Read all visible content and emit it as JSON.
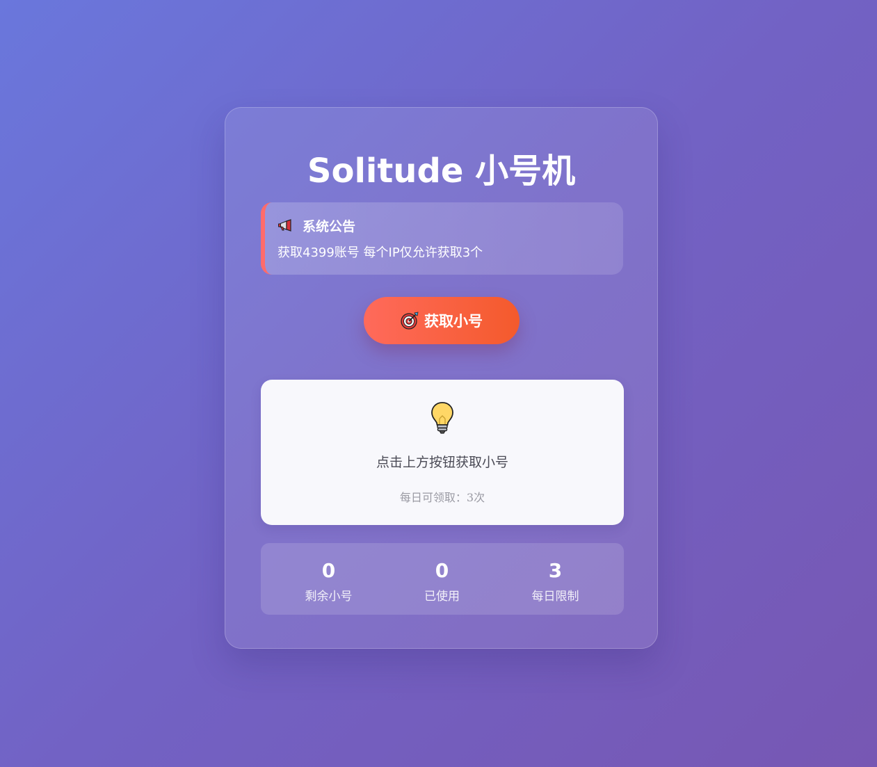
{
  "app": {
    "title": "Solitude 小号机"
  },
  "notice": {
    "icon": "megaphone-icon",
    "heading": "系统公告",
    "text": "获取4399账号 每个IP仅允许获取3个",
    "accent_color": "#ff6b6b"
  },
  "action": {
    "icon": "target-icon",
    "label": "获取小号",
    "color": "#f45a2c"
  },
  "result": {
    "icon": "lightbulb-icon",
    "message": "点击上方按钮获取小号",
    "hint": "每日可领取：3次"
  },
  "stats": [
    {
      "value": "0",
      "label": "剩余小号"
    },
    {
      "value": "0",
      "label": "已使用"
    },
    {
      "value": "3",
      "label": "每日限制"
    }
  ]
}
